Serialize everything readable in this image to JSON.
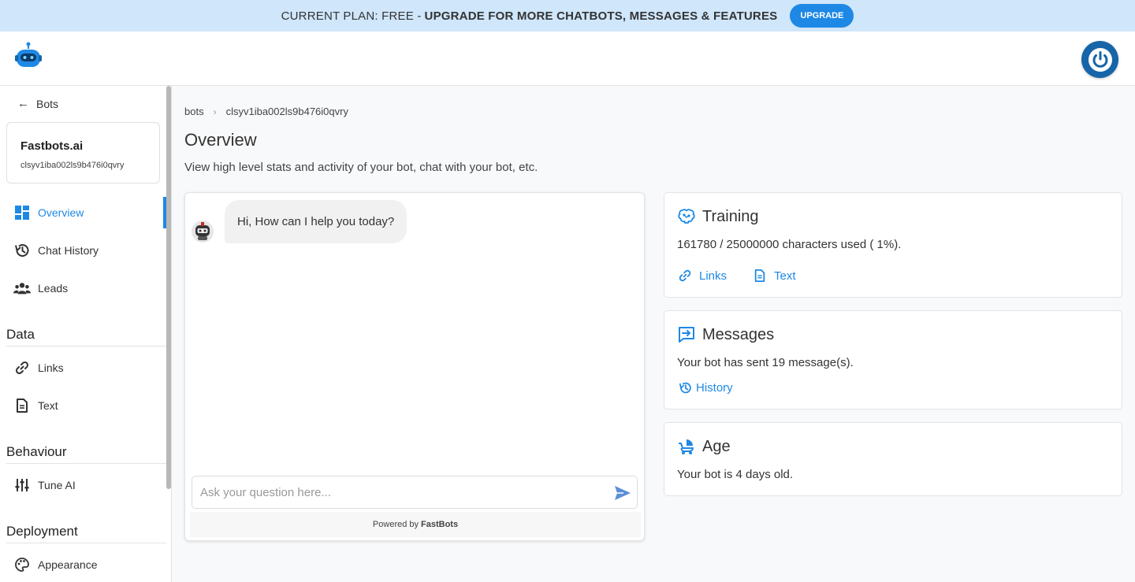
{
  "banner": {
    "plan_text": "Current Plan: Free -",
    "upgrade_text": "Upgrade for more chatbots, messages & features",
    "upgrade_button": "Upgrade"
  },
  "sidebar": {
    "back_label": "Bots",
    "bot": {
      "name": "Fastbots.ai",
      "id": "clsyv1iba002ls9b476i0qvry"
    },
    "nav": [
      {
        "label": "Overview",
        "icon": "dashboard-icon",
        "active": true
      },
      {
        "label": "Chat History",
        "icon": "history-icon"
      },
      {
        "label": "Leads",
        "icon": "people-icon"
      }
    ],
    "sections": {
      "data": {
        "title": "Data",
        "items": [
          {
            "label": "Links",
            "icon": "link-icon"
          },
          {
            "label": "Text",
            "icon": "document-icon"
          }
        ]
      },
      "behaviour": {
        "title": "Behaviour",
        "items": [
          {
            "label": "Tune AI",
            "icon": "sliders-icon"
          }
        ]
      },
      "deployment": {
        "title": "Deployment",
        "items": [
          {
            "label": "Appearance",
            "icon": "palette-icon"
          }
        ]
      }
    }
  },
  "main": {
    "breadcrumb": [
      "bots",
      "clsyv1iba002ls9b476i0qvry"
    ],
    "title": "Overview",
    "subtitle": "View high level stats and activity of your bot, chat with your bot, etc."
  },
  "chat": {
    "greeting": "Hi, How can I help you today?",
    "input_placeholder": "Ask your question here...",
    "powered_prefix": "Powered by",
    "powered_brand": "FastBots"
  },
  "cards": {
    "training": {
      "title": "Training",
      "usage_text": "161780 / 25000000 characters used ( 1%).",
      "links_label": "Links",
      "text_label": "Text"
    },
    "messages": {
      "title": "Messages",
      "body": "Your bot has sent 19 message(s).",
      "history_label": "History"
    },
    "age": {
      "title": "Age",
      "body": "Your bot is 4 days old."
    }
  },
  "colors": {
    "accent": "#1e88e5",
    "banner_bg": "#cfe6fb",
    "power_button": "#1565a8"
  }
}
